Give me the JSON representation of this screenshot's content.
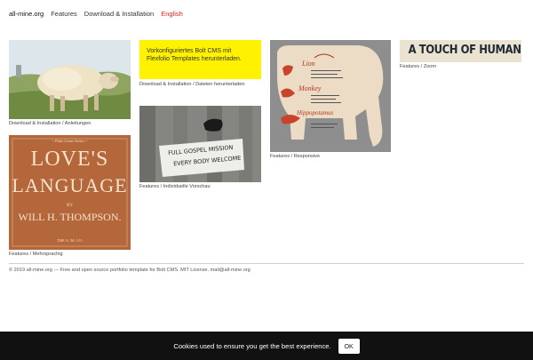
{
  "nav": {
    "brand": "all-mine.org",
    "features": "Features",
    "download": "Download & Installation",
    "language": "English"
  },
  "tiles": {
    "sheep": {
      "caption": "Download & Installation / Anleitungen"
    },
    "promo": {
      "text": "Vorkonfiguriertes Bolt CMS mit Flexfolio Templates herunterladen.",
      "caption": "Download & Installation / Dateien herunterladen"
    },
    "elephant": {
      "caption": "Features / Responsive",
      "menu_lion": "Lion",
      "menu_monkey": "Monkey",
      "menu_hippo": "Hippopotamus"
    },
    "humanity": {
      "caption": "Features / Zoom",
      "text": "A TOUCH OF HUMANITY."
    },
    "sign": {
      "caption": "Features / Individuelle Vorschau",
      "sign_line1": "FULL GOSPEL MISSION",
      "sign_line2": "EVERY BODY WELCOME"
    },
    "book": {
      "caption": "Features / Mehrsprachig",
      "top_text": "~ Phila Gems Series ~",
      "title1": "LOVE'S",
      "title2": "LANGUAGE",
      "by": "BY",
      "author": "WILL H. THOMPSON.",
      "publisher": "THE A. M. CO."
    }
  },
  "footer": {
    "text": "© 2019 all-mine.org --- Free and open source portfolio template for Bolt CMS. MIT License. mail@all-mine.org"
  },
  "cookie": {
    "text": "Cookies used to ensure you get the best experience.",
    "button": "OK"
  },
  "colors": {
    "accent_red": "#e2231a",
    "promo_yellow": "#fff200",
    "cookie_bg": "#111111"
  }
}
